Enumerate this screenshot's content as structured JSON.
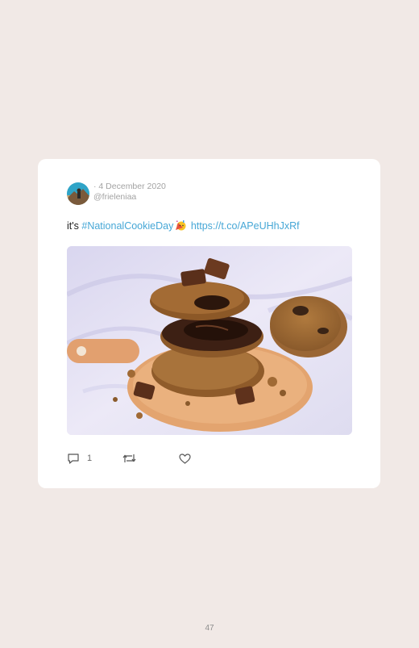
{
  "tweet": {
    "date": "4 December 2020",
    "handle": "@frieleniaa",
    "text_prefix": "it's",
    "hashtag": "#NationalCookieDay",
    "emoji": "party-face-emoji",
    "url": "https://t.co/APeUHhJxRf",
    "reply_count": "1",
    "photo": "cookie-stack-photo"
  },
  "footer": {
    "page_number": "47"
  },
  "icons": {
    "reply": "reply-icon",
    "retweet": "retweet-icon",
    "like": "heart-icon"
  },
  "colors": {
    "background": "#f1e9e6",
    "link": "#46a7d6",
    "meta_text": "#a3a3a3"
  }
}
